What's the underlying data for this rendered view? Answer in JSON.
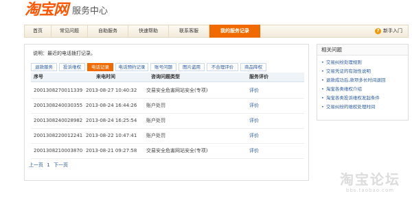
{
  "logo": {
    "brand": "淘宝网",
    "subtitle": "服务中心"
  },
  "nav": {
    "items": [
      "首页",
      "常见问题",
      "自助服务",
      "快速帮助",
      "联系客服",
      "我的服务记录"
    ],
    "active_index": 5,
    "help_label": "新手入门"
  },
  "main": {
    "description": "说明：最近的电话拨打记录。",
    "tabs": [
      "退款服务",
      "投诉维权",
      "电话记录",
      "电话预约记录",
      "账号问题",
      "图片盗用",
      "不合理评价",
      "商品降权"
    ],
    "active_tab_index": 2,
    "table": {
      "headers": [
        "序号",
        "来电时间",
        "咨询问题类型",
        "服务评价"
      ],
      "rows": [
        [
          "2001308270011339",
          "2013-08-27 10:40:32",
          "交易安全危害网站安全(专项)",
          "评价"
        ],
        [
          "2001308240030355",
          "2013-08-24 16:44:26",
          "账户处罚",
          "评价"
        ],
        [
          "2001308240028982",
          "2013-08-24 16:25:54",
          "账户处罚",
          "评价"
        ],
        [
          "2001308220012241",
          "2013-08-22 10:47:41",
          "账户处罚",
          "评价"
        ],
        [
          "2001308210003870",
          "2013-08-21 09:27:58",
          "交易安全危害网站安全(专项)",
          "评价"
        ]
      ]
    },
    "pager": {
      "prev": "上一页",
      "page": "1",
      "next": "下一页"
    }
  },
  "sidebar": {
    "title": "相关问题",
    "links": [
      "交易纠纷处理规则",
      "交易凭证的有效性说明",
      "退款成功后,款项多长时间退回",
      "淘宝各类维权介绍",
      "淘宝各类投诉维权发起条件",
      "交易纠纷的维权处理时间"
    ]
  },
  "watermark": {
    "main": "淘宝论坛",
    "sub": "bbs.taobao.com"
  },
  "colors": {
    "accent": "#f06a00",
    "link": "#2a5aa8",
    "brand": "#ff5500"
  }
}
